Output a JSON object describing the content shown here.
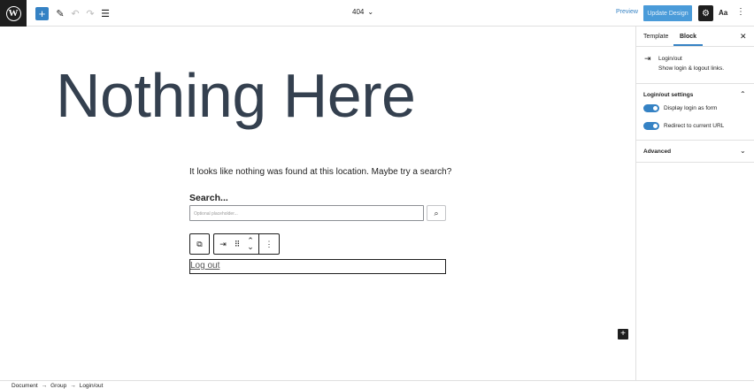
{
  "toolbar": {
    "add_label": "+",
    "document_title": "404",
    "title_chevron": "⌄",
    "preview_label": "Preview",
    "update_label": "Update Design",
    "styles_label": "Aa",
    "more_label": "⋮"
  },
  "canvas": {
    "heading": "Nothing Here",
    "paragraph": "It looks like nothing was found at this location. Maybe try a search?",
    "search_label": "Search...",
    "search_placeholder": "Optional placeholder...",
    "logout_link": "Log out"
  },
  "sidebar": {
    "tab_template": "Template",
    "tab_block": "Block",
    "block_title": "Login/out",
    "block_description": "Show login & logout links.",
    "settings_panel_title": "Login/out settings",
    "toggle_form": "Display login as form",
    "toggle_redirect": "Redirect to current URL",
    "advanced_title": "Advanced",
    "accent_color": "#3582c4"
  },
  "footer": {
    "crumbs": [
      "Document",
      "Group",
      "Login/out"
    ],
    "separator": "→"
  }
}
